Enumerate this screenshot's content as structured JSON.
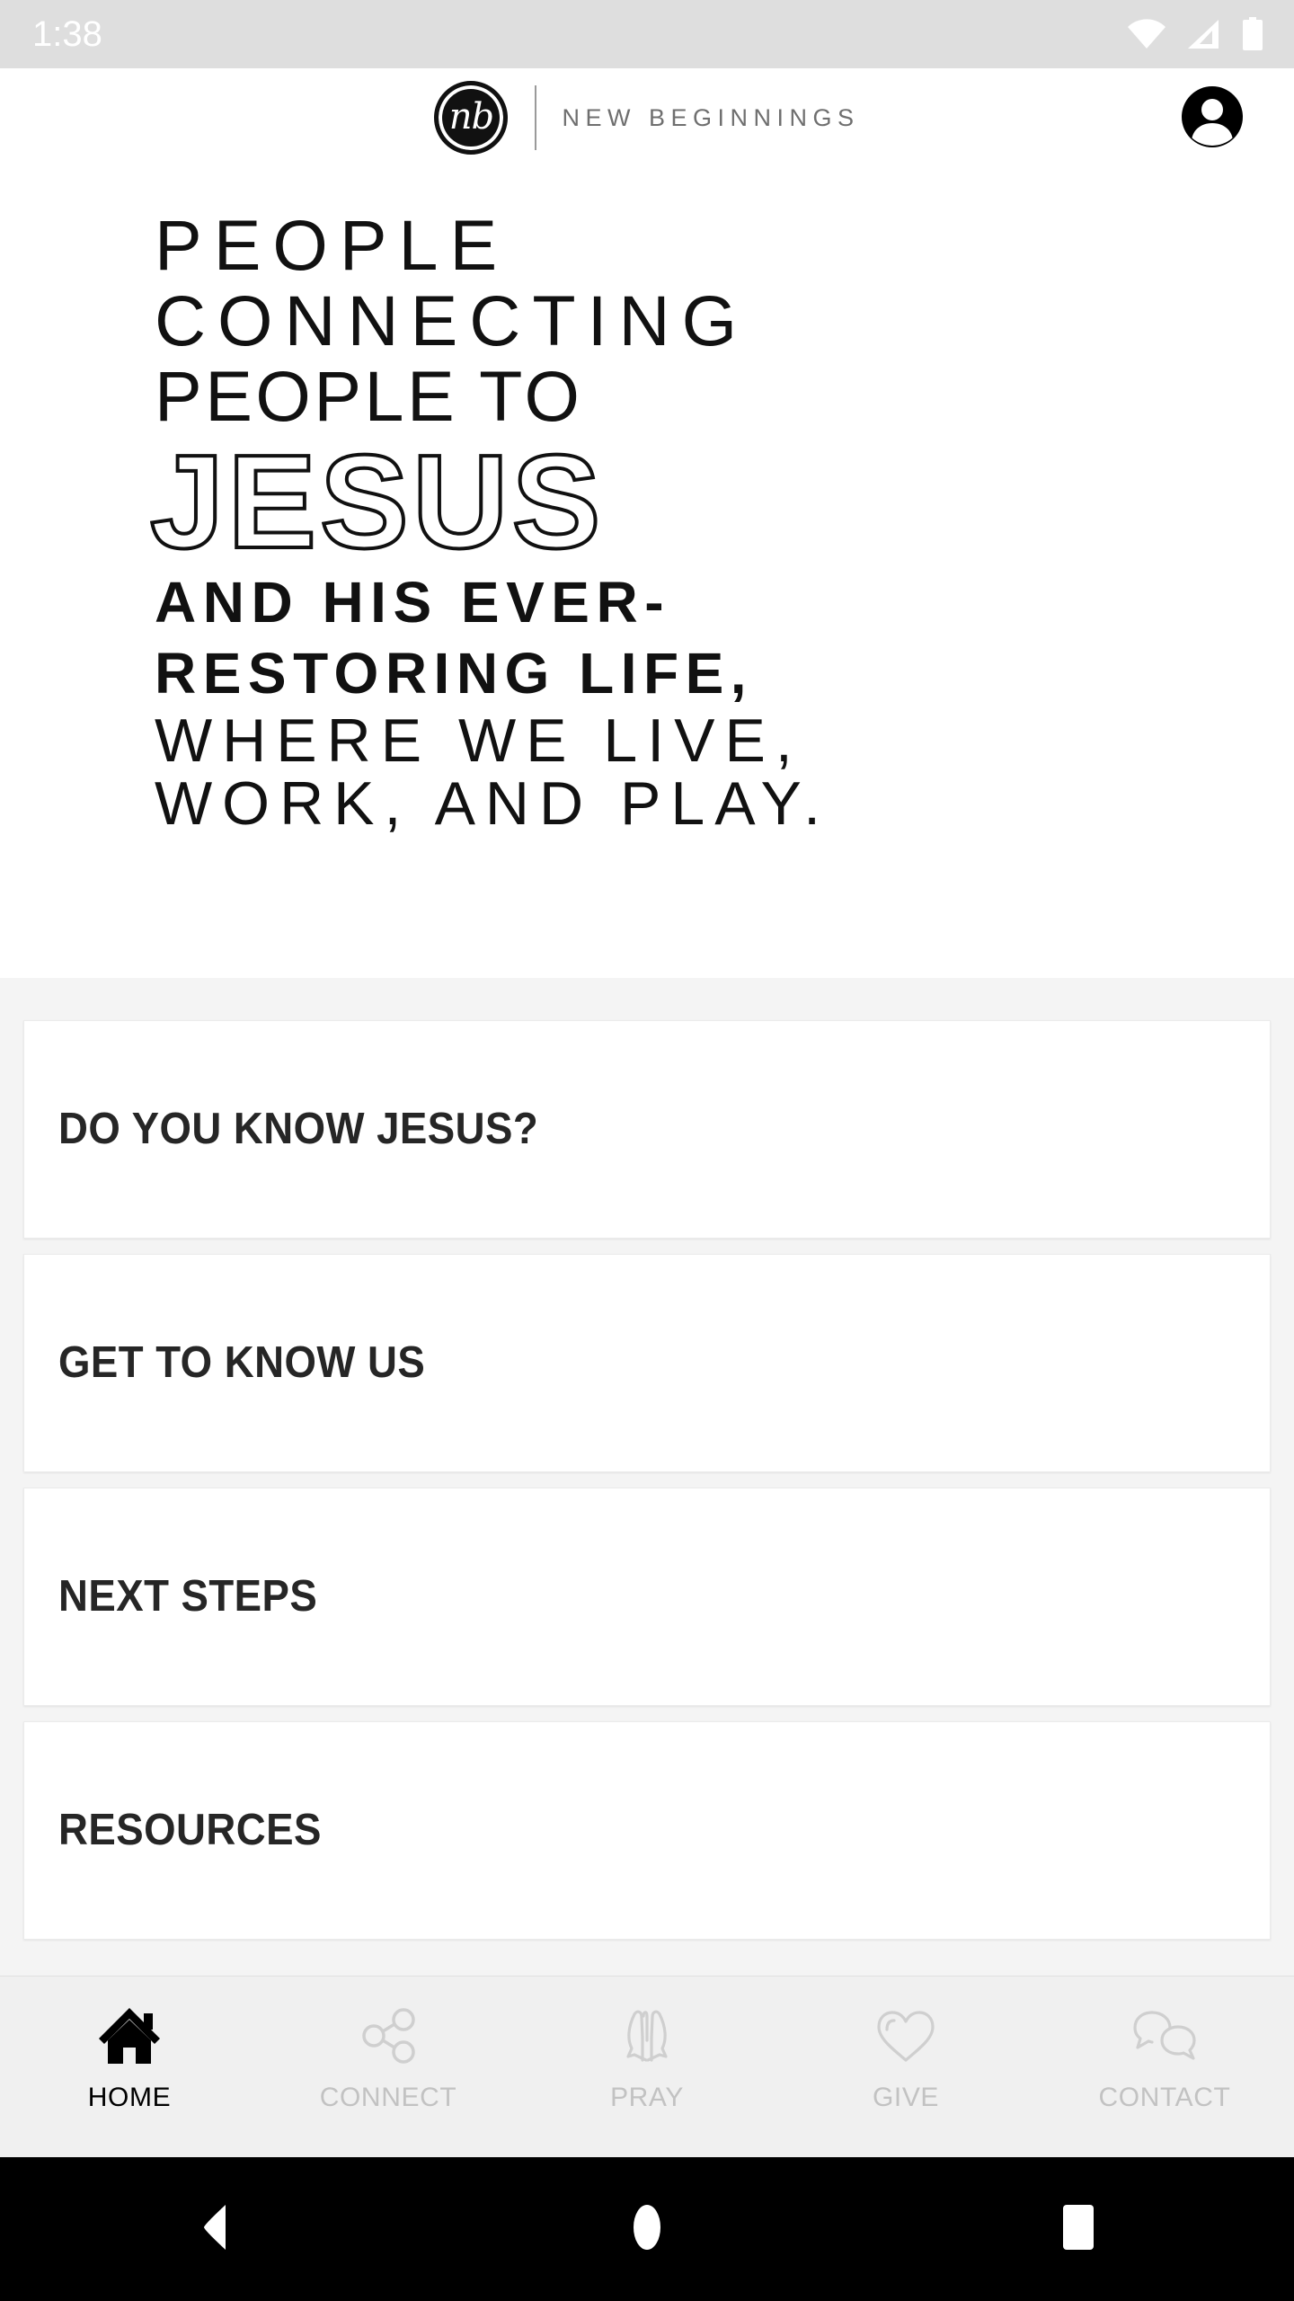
{
  "status_bar": {
    "time": "1:38",
    "icons": [
      "wifi-icon",
      "cellular-signal-icon",
      "battery-icon"
    ],
    "background": "#dedede",
    "foreground": "#ffffff"
  },
  "header": {
    "logo_monogram": "nb",
    "brand_name": "NEW BEGINNINGS",
    "account_icon": "account-circle-icon"
  },
  "hero": {
    "lines": [
      {
        "text": "PEOPLE",
        "style": "thin"
      },
      {
        "text": "CONNECTING",
        "style": "thin"
      },
      {
        "text": "PEOPLE TO",
        "style": "thin-tight"
      },
      {
        "text": "JESUS",
        "style": "outline"
      },
      {
        "text": "AND HIS EVER-",
        "style": "bold"
      },
      {
        "text": "RESTORING LIFE,",
        "style": "bold"
      },
      {
        "text": "WHERE WE LIVE,",
        "style": "thin-small"
      },
      {
        "text": "WORK, AND PLAY.",
        "style": "thin-small"
      }
    ],
    "text_color": "#111111",
    "background": "#ffffff"
  },
  "main": {
    "background": "#f4f4f4",
    "cards": [
      {
        "title": "DO YOU KNOW JESUS?"
      },
      {
        "title": "GET TO KNOW US"
      },
      {
        "title": "NEXT STEPS"
      },
      {
        "title": "RESOURCES"
      }
    ]
  },
  "bottom_nav": {
    "background": "#f0f0f0",
    "active_color": "#000000",
    "inactive_color": "#c2c2c2",
    "items": [
      {
        "label": "HOME",
        "icon": "home-icon",
        "active": true
      },
      {
        "label": "CONNECT",
        "icon": "share-network-icon",
        "active": false
      },
      {
        "label": "PRAY",
        "icon": "praying-hands-icon",
        "active": false
      },
      {
        "label": "GIVE",
        "icon": "heart-icon",
        "active": false
      },
      {
        "label": "CONTACT",
        "icon": "chat-bubbles-icon",
        "active": false
      }
    ]
  },
  "android_nav": {
    "background": "#000000",
    "buttons": [
      "back-icon",
      "home-icon",
      "recents-icon"
    ]
  }
}
